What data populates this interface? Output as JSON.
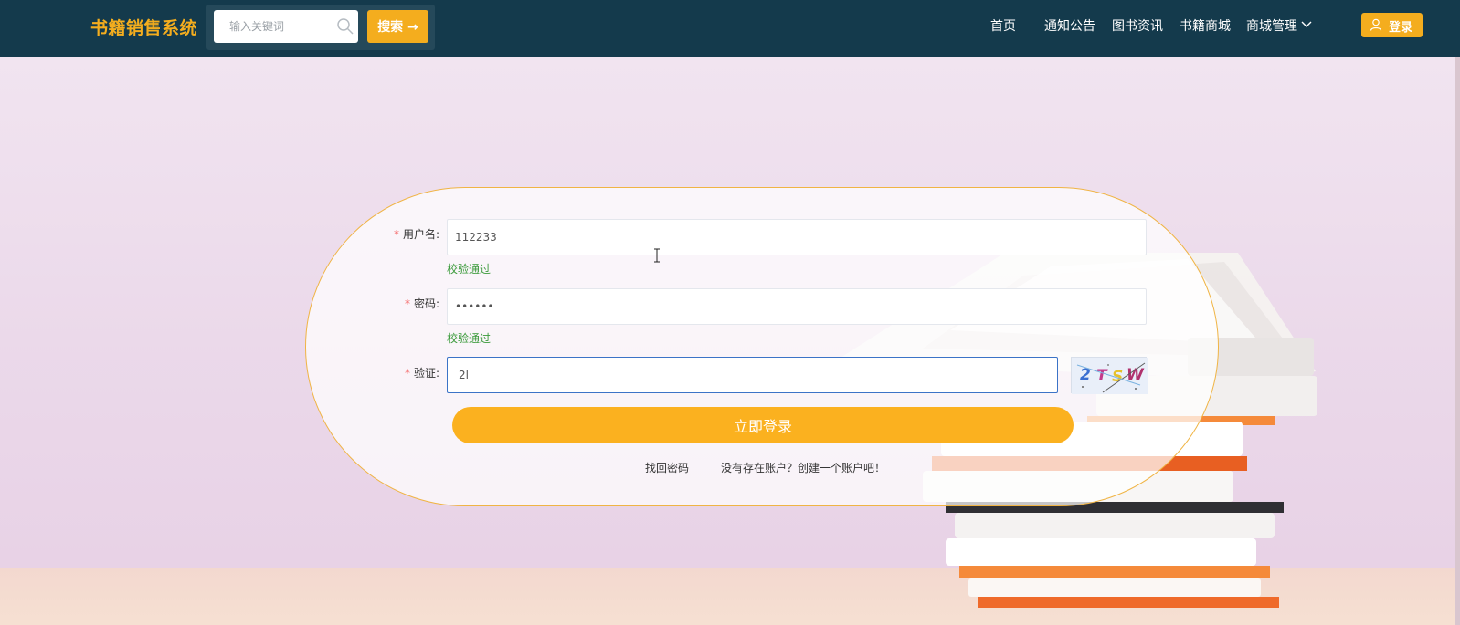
{
  "header": {
    "brand": "书籍销售系统",
    "search_placeholder": "输入关键词",
    "search_button": "搜索 →",
    "nav": [
      "首页",
      "通知公告",
      "图书资讯",
      "书籍商城",
      "商城管理"
    ],
    "login_button": "登录"
  },
  "form": {
    "username": {
      "label": "用户名:",
      "value": "112233",
      "hint": "校验通过"
    },
    "password": {
      "label": "密码:",
      "value": "••••••",
      "hint": "校验通过"
    },
    "captcha": {
      "label": "验证:",
      "value": "2l",
      "image_text": "2TSW"
    },
    "required_mark": "*",
    "submit": "立即登录",
    "forgot_link": "找回密码",
    "register_link": "没有存在账户？创建一个账户吧！"
  },
  "colors": {
    "header_bg": "#143a4c",
    "accent": "#f4ad1e",
    "valid_hint": "#3a9a3a",
    "required": "#f56c6c"
  }
}
